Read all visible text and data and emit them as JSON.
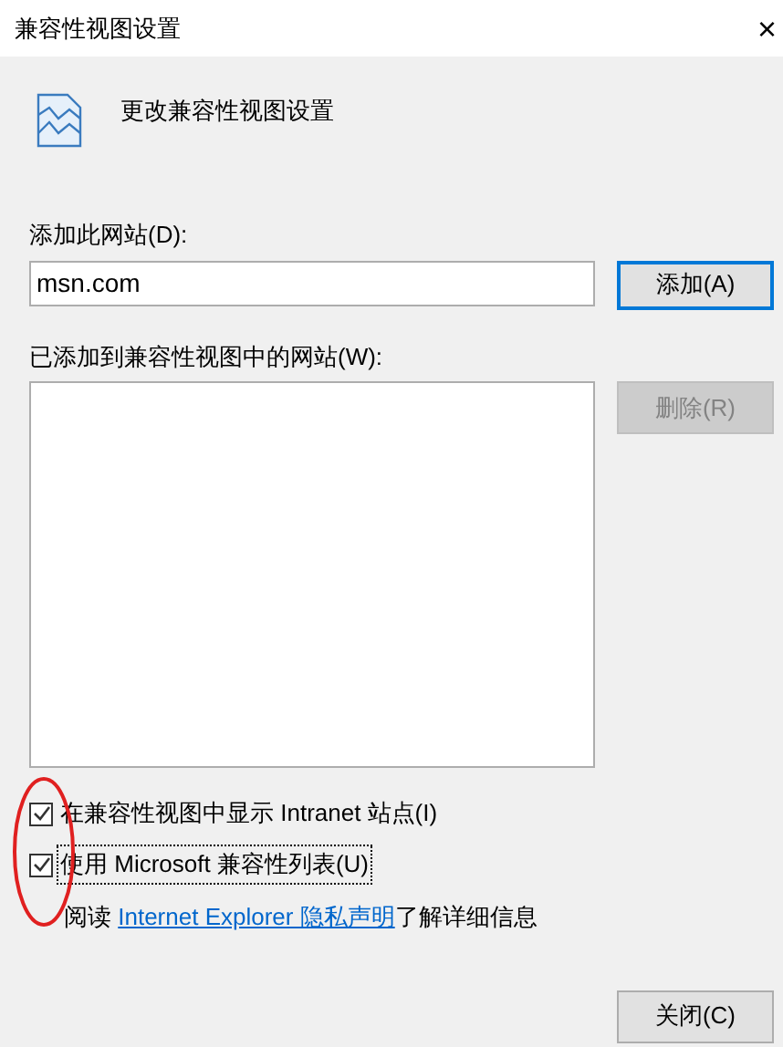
{
  "window": {
    "title": "兼容性视图设置",
    "close": "×"
  },
  "header": "更改兼容性视图设置",
  "add_site": {
    "label": "添加此网站(D):",
    "value": "msn.com",
    "button": "添加(A)"
  },
  "added_sites": {
    "label": "已添加到兼容性视图中的网站(W):",
    "button": {
      "label": "删除(R)",
      "disabled": true
    }
  },
  "options": [
    {
      "label": "在兼容性视图中显示 Intranet 站点(I)",
      "checked": true,
      "focused": false
    },
    {
      "label": "使用 Microsoft 兼容性列表(U)",
      "checked": true,
      "focused": true
    }
  ],
  "privacy": {
    "before": "阅读 ",
    "link": "Internet Explorer 隐私声明",
    "after": "了解详细信息"
  },
  "close_button": "关闭(C)"
}
